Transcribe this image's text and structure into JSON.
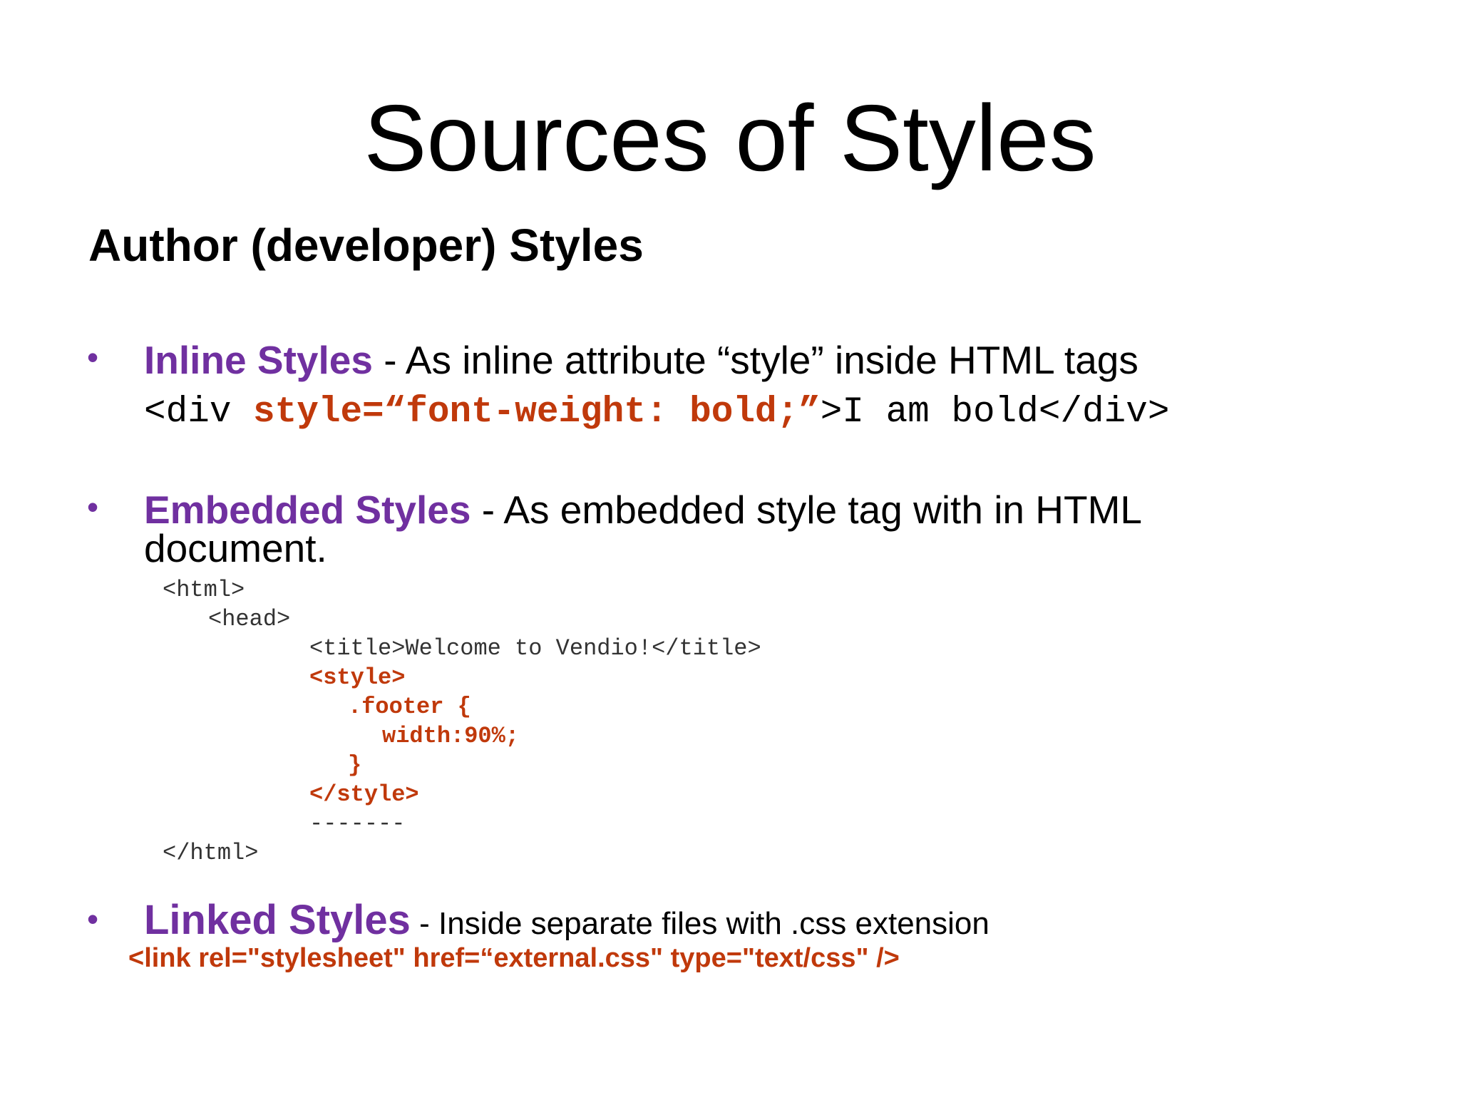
{
  "slide": {
    "title": "Sources of Styles",
    "subtitle": "Author (developer) Styles",
    "bullet_glyph": "•",
    "inline": {
      "term": "Inline Styles",
      "desc": " - As inline attribute “style” inside HTML tags",
      "code_open": "<div ",
      "code_attr": "style=“font-weight: bold;”",
      "code_close": ">I am bold</div>"
    },
    "embedded": {
      "term": "Embedded Styles",
      "desc_line1": " -  As embedded style tag with in HTML",
      "desc_line2": "document.",
      "code_lines": [
        "<html>",
        "<head>",
        "<title>Welcome to Vendio!</title>",
        "<style>",
        ".footer {",
        "width:90%;",
        "}",
        "</style>",
        "-------",
        "</html>"
      ]
    },
    "linked": {
      "term": "Linked Styles",
      "desc": " - Inside separate files with .css extension",
      "code": "<link rel=\"stylesheet\" href=“external.css\" type=\"text/css\" />"
    }
  },
  "colors": {
    "term": "#7030a0",
    "code_accent": "#c0390b",
    "code_plain": "#333333",
    "text": "#000000",
    "background": "#ffffff"
  }
}
